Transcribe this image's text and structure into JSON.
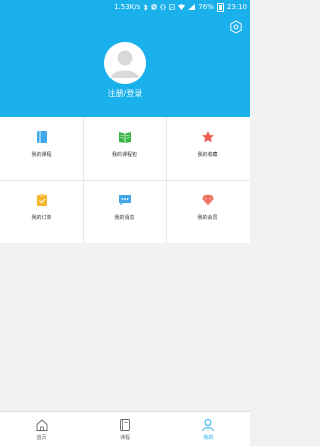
{
  "status_bar": {
    "speed": "1.53K/s",
    "battery_pct": "76%",
    "time": "23:10"
  },
  "header": {
    "login_label": "注册/登录"
  },
  "grid": {
    "items": [
      {
        "label": "我的课程",
        "icon": "book-icon",
        "color": "#3fa8e8"
      },
      {
        "label": "我的课程包",
        "icon": "open-book-icon",
        "color": "#39b549"
      },
      {
        "label": "我的收藏",
        "icon": "star-icon",
        "color": "#ee5a4d"
      },
      {
        "label": "我的订单",
        "icon": "order-icon",
        "color": "#f5b52a"
      },
      {
        "label": "我的消息",
        "icon": "message-icon",
        "color": "#43a5e6"
      },
      {
        "label": "我的会员",
        "icon": "diamond-icon",
        "color": "#f06552"
      }
    ]
  },
  "tabbar": {
    "tabs": [
      {
        "label": "首页",
        "icon": "home-icon"
      },
      {
        "label": "课程",
        "icon": "course-icon"
      },
      {
        "label": "我的",
        "icon": "person-icon"
      }
    ],
    "active_index": 2
  },
  "colors": {
    "primary": "#1ab0ec",
    "background": "#f2f2f2",
    "divider": "#e8e8e8"
  }
}
